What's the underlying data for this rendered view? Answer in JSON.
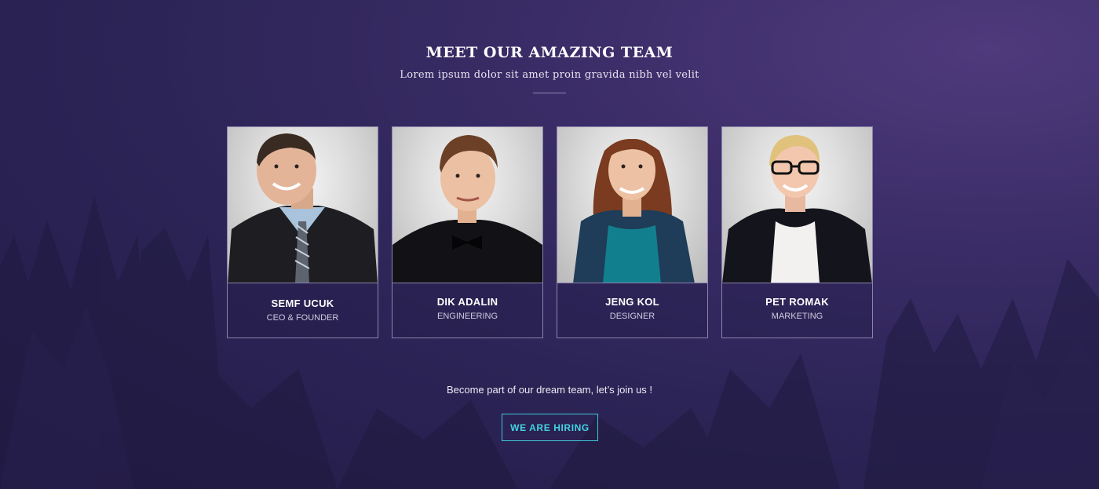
{
  "header": {
    "title": "MEET OUR AMAZING TEAM",
    "subtitle": "Lorem ipsum dolor sit amet proin gravida nibh vel velit"
  },
  "team": [
    {
      "name": "SEMF UCUK",
      "role": "CEO & FOUNDER"
    },
    {
      "name": "DIK ADALIN",
      "role": "ENGINEERING"
    },
    {
      "name": "JENG KOL",
      "role": "DESIGNER"
    },
    {
      "name": "PET ROMAK",
      "role": "MARKETING"
    }
  ],
  "cta": {
    "text": "Become part of our dream team, let’s join us !",
    "button_label": "WE ARE HIRING"
  },
  "colors": {
    "background": "#2c2456",
    "accent": "#44d3e1",
    "card_border": "#8c83ad"
  }
}
